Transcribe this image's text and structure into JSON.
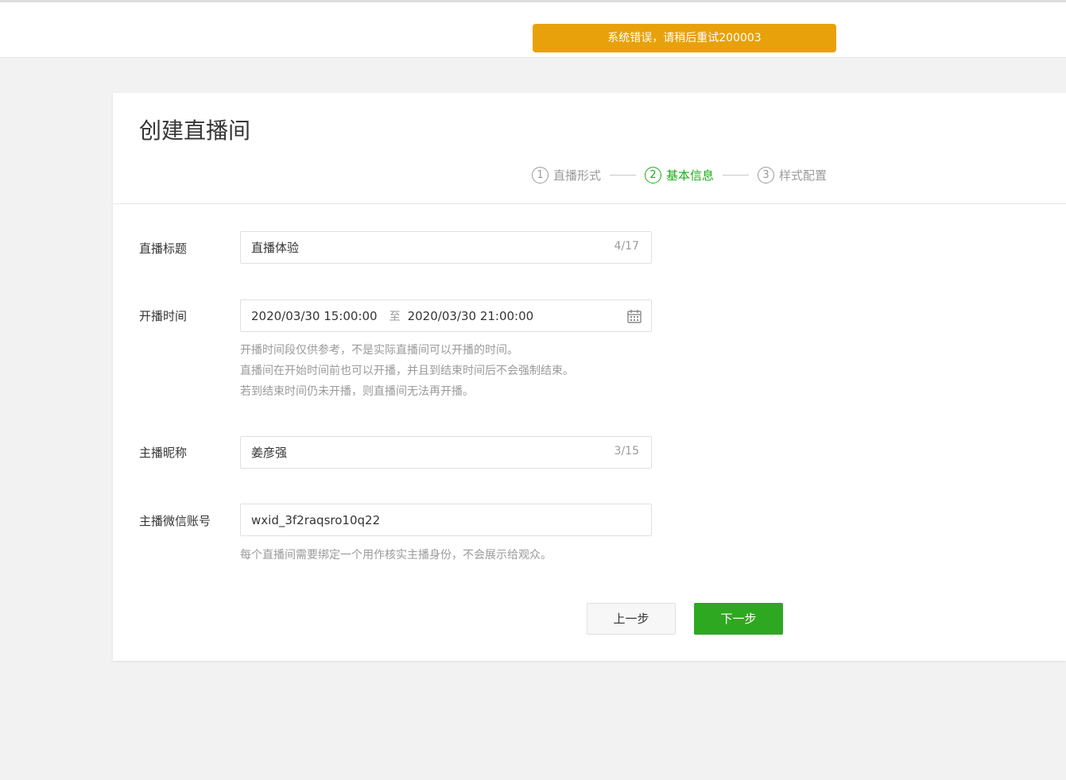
{
  "toast": {
    "message": "系统错误，请稍后重试200003",
    "color": "#e8a10a"
  },
  "page": {
    "title": "创建直播间"
  },
  "steps": [
    {
      "num": "1",
      "label": "直播形式",
      "active": false
    },
    {
      "num": "2",
      "label": "基本信息",
      "active": true
    },
    {
      "num": "3",
      "label": "样式配置",
      "active": false
    }
  ],
  "form": {
    "title": {
      "label": "直播标题",
      "value": "直播体验",
      "counter": "4/17"
    },
    "time": {
      "label": "开播时间",
      "start": "2020/03/30 15:00:00",
      "separator": "至",
      "end": "2020/03/30 21:00:00",
      "hints": [
        "开播时间段仅供参考，不是实际直播间可以开播的时间。",
        "直播间在开始时间前也可以开播，并且到结束时间后不会强制结束。",
        "若到结束时间仍未开播，则直播间无法再开播。"
      ]
    },
    "nickname": {
      "label": "主播昵称",
      "value": "姜彦强",
      "counter": "3/15"
    },
    "wechat": {
      "label": "主播微信账号",
      "value": "wxid_3f2raqsro10q22",
      "hint": "每个直播间需要绑定一个用作核实主播身份，不会展示给观众。"
    }
  },
  "buttons": {
    "prev": "上一步",
    "next": "下一步"
  },
  "colors": {
    "accent": "#1aad19",
    "primary_button": "#2ea821"
  },
  "icons": {
    "calendar": "calendar-icon"
  }
}
